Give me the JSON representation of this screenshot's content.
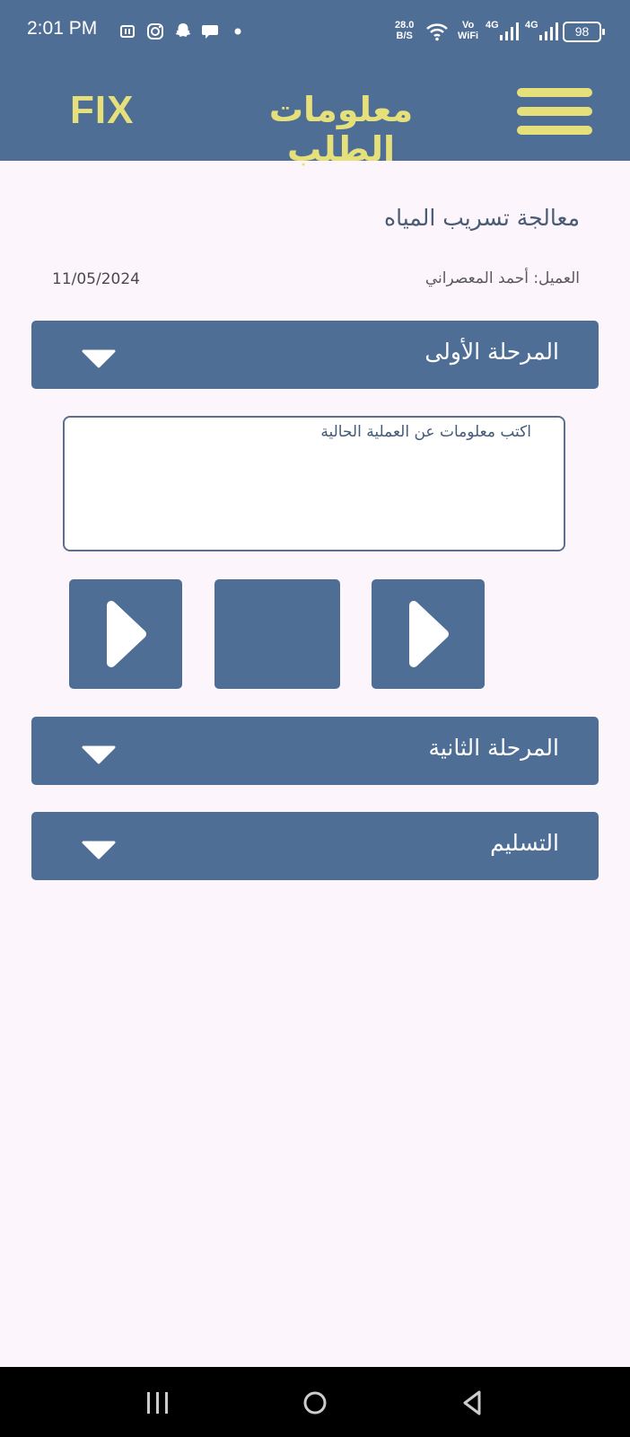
{
  "status_bar": {
    "time": "2:01 PM",
    "speed_value": "28.0",
    "speed_unit": "B/S",
    "vowifi_top": "Vo",
    "vowifi_bottom": "WiFi",
    "network_1": "4G",
    "network_2": "4G",
    "battery": "98"
  },
  "app_bar": {
    "brand": "FIX",
    "title": "معلومات الطلب",
    "menu_icon": "hamburger-menu-icon"
  },
  "order": {
    "service_title": "معالجة تسريب المياه",
    "client_label": "العميل: أحمد المعصراني",
    "date": "11/05/2024"
  },
  "stages": [
    {
      "label": "المرحلة الأولى",
      "expanded": true
    },
    {
      "label": "المرحلة الثانية",
      "expanded": false
    },
    {
      "label": "التسليم",
      "expanded": false
    }
  ],
  "notes": {
    "placeholder": "اكتب معلومات عن العملية الحالية",
    "value": ""
  },
  "media": [
    {
      "icon": "play-icon"
    },
    {
      "icon": "blank"
    },
    {
      "icon": "play-icon"
    }
  ],
  "colors": {
    "primary": "#4f6e96",
    "accent": "#e6e07a",
    "background": "#fcf6fc"
  }
}
